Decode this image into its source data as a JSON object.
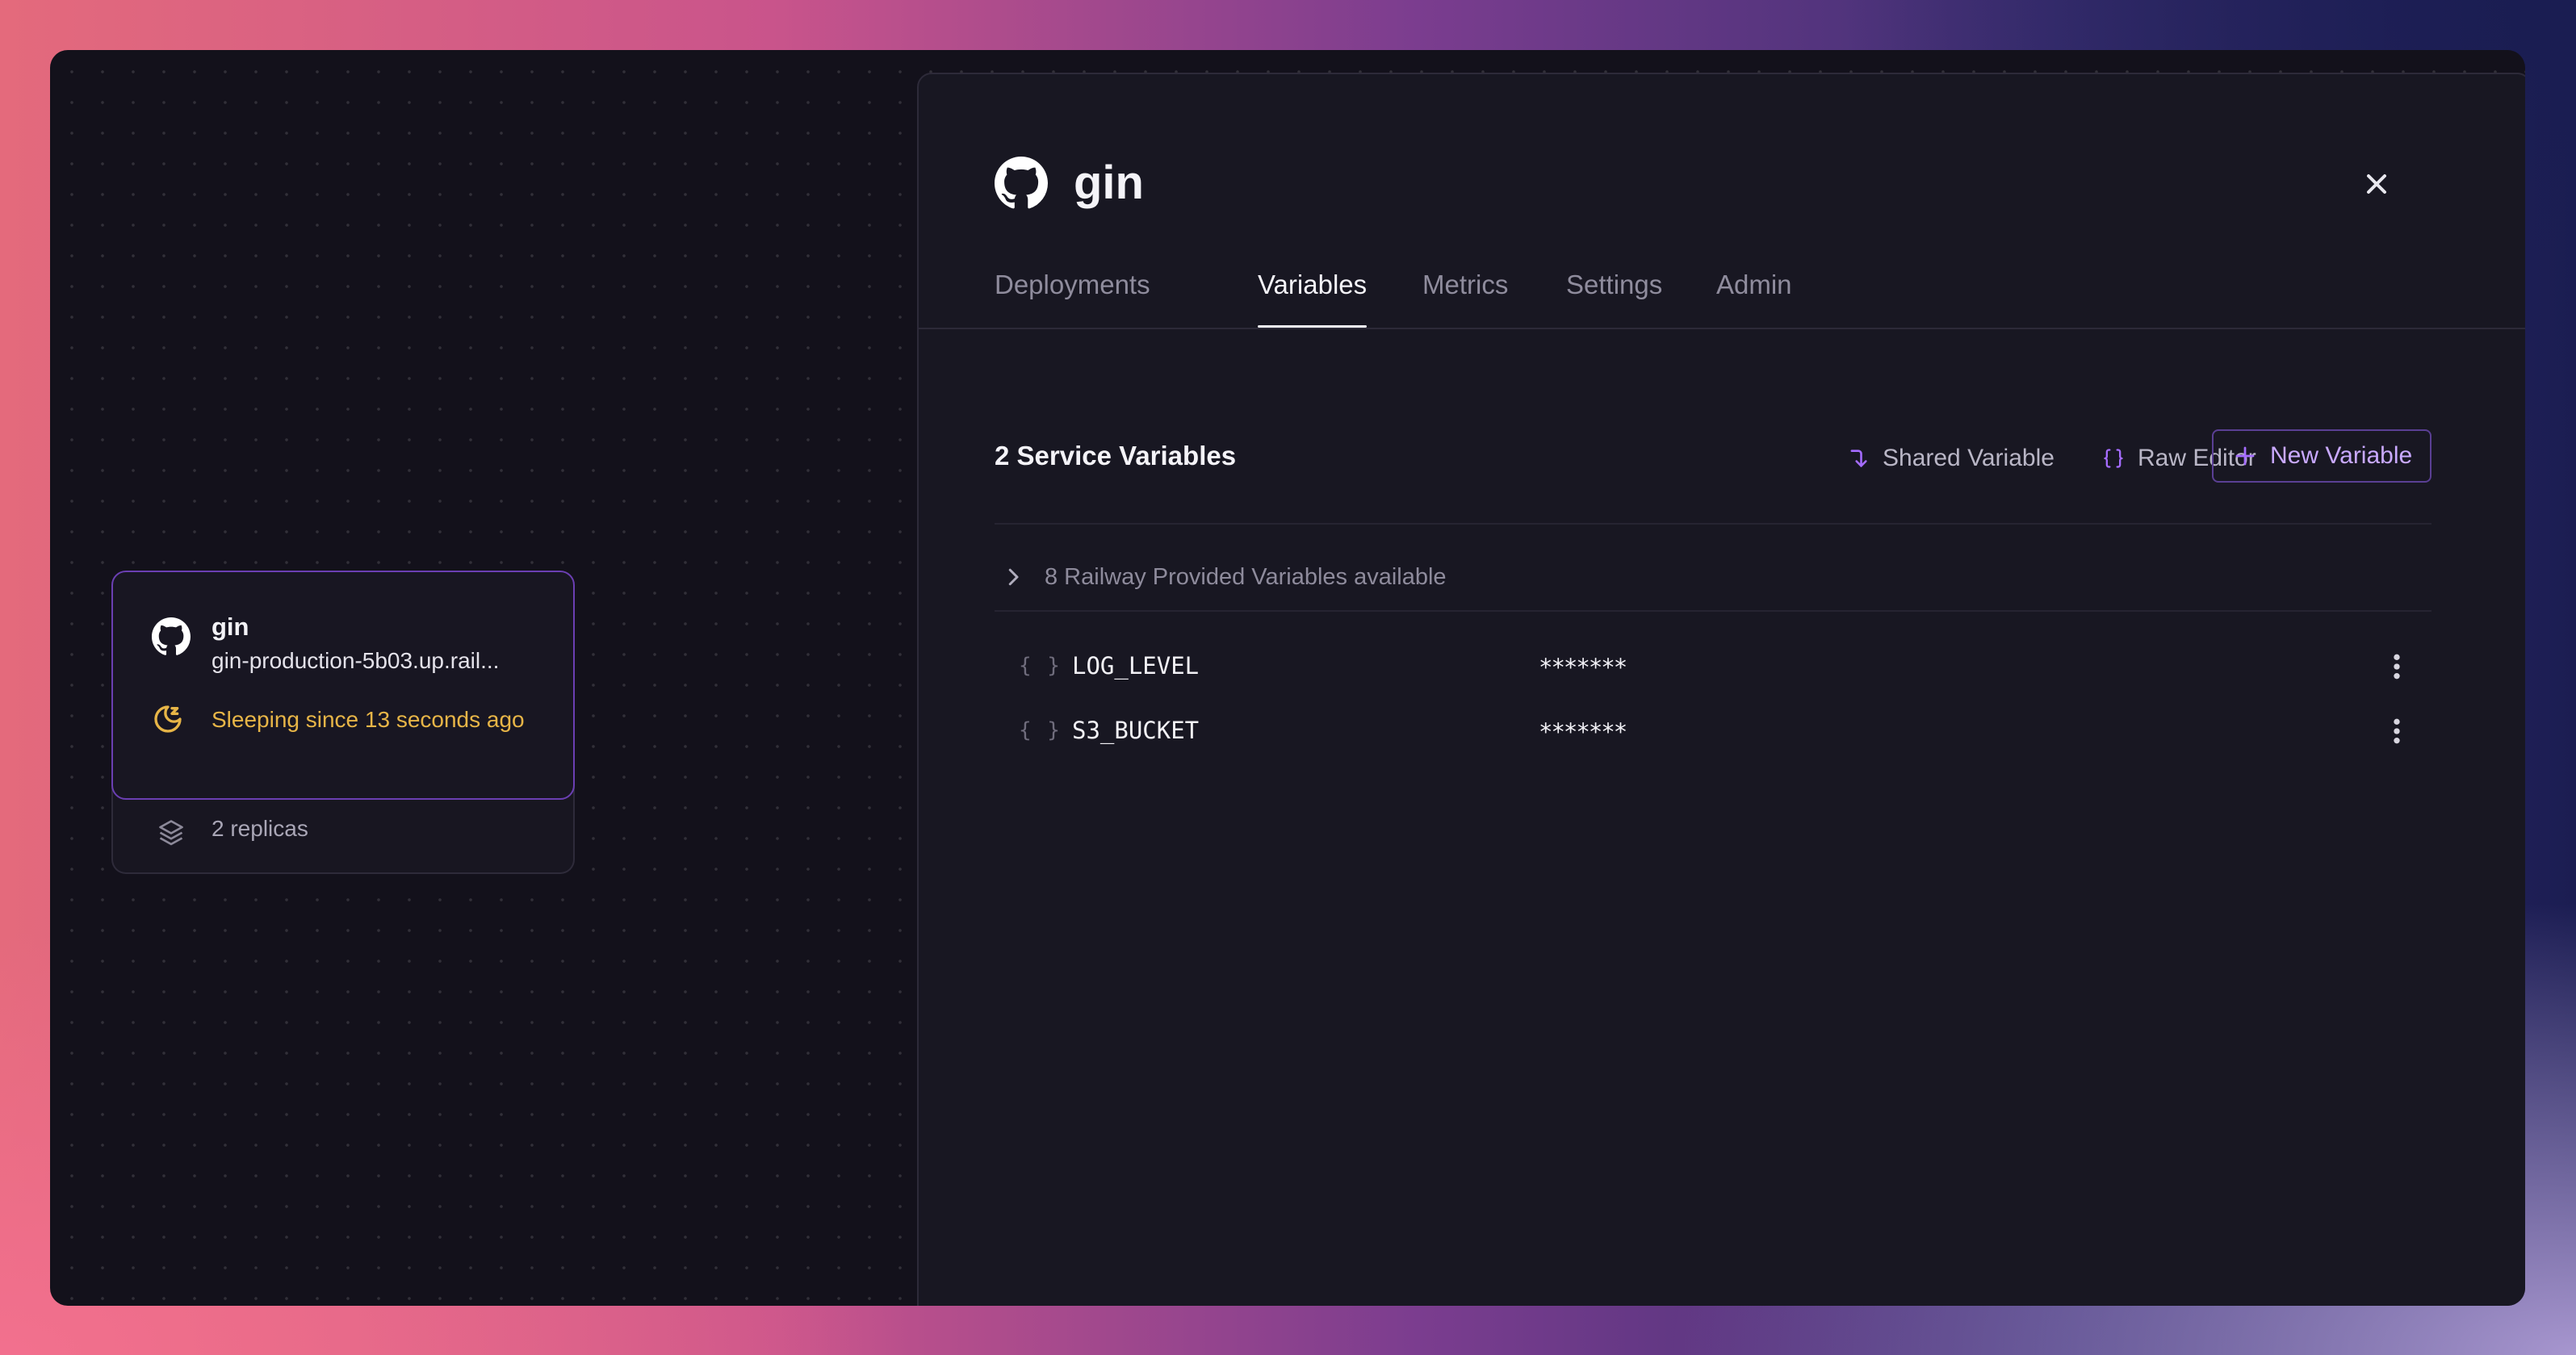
{
  "service_card": {
    "name": "gin",
    "url": "gin-production-5b03.up.rail...",
    "status": "Sleeping since 13 seconds ago",
    "replicas": "2 replicas",
    "status_color": "#e7b547",
    "border_color": "#6b3fb3"
  },
  "panel": {
    "title": "gin",
    "tabs": [
      {
        "label": "Deployments",
        "active": false
      },
      {
        "label": "Variables",
        "active": true
      },
      {
        "label": "Metrics",
        "active": false
      },
      {
        "label": "Settings",
        "active": false
      },
      {
        "label": "Admin",
        "active": false
      }
    ],
    "section_title": "2 Service Variables",
    "actions": {
      "shared_variable": "Shared Variable",
      "raw_editor": "Raw Editor",
      "new_variable": "New Variable"
    },
    "railway_variables": "8 Railway Provided Variables available",
    "variables": [
      {
        "key": "LOG_LEVEL",
        "value": "*******",
        "icon": "{ }"
      },
      {
        "key": "S3_BUCKET",
        "value": "*******",
        "icon": "{ }"
      }
    ],
    "accent_color": "#a56cff"
  }
}
